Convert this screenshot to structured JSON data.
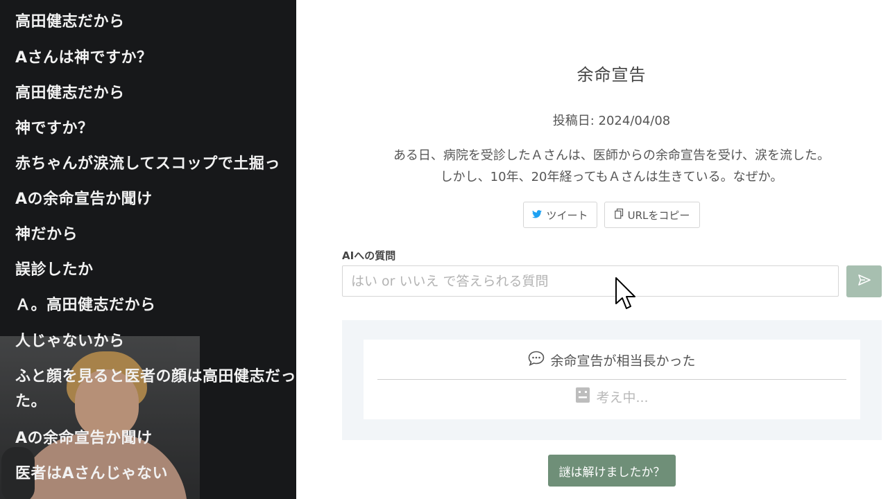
{
  "chat": {
    "messages": [
      "高田健志だから",
      "Aさんは神ですか？",
      "高田健志だから",
      "神ですか？",
      "赤ちゃんが涙流してスコップで土掘っ",
      "Aの余命宣告か聞け",
      "神だから",
      "誤診したか",
      "Ａ。高田健志だから",
      "人じゃないから",
      "ふと顔を見ると医者の顔は高田健志だった。",
      "Aの余命宣告か聞け",
      "医者はAさんじゃない"
    ]
  },
  "page": {
    "title": "余命宣告",
    "post_date": "投稿日: 2024/04/08",
    "story_line1": "ある日、病院を受診したＡさんは、医師からの余命宣告を受け、涙を流した。",
    "story_line2": "しかし、10年、20年経ってもＡさんは生きている。なぜか。",
    "share": {
      "tweet_label": "ツイート",
      "copy_label": "URLをコピー"
    },
    "question_label": "AIへの質問",
    "question_placeholder": "はい or いいえ で答えられる質問",
    "answer": {
      "question": "余命宣告が相当長かった",
      "status": "考え中..."
    },
    "solved_button": "謎は解けましたか？"
  },
  "colors": {
    "chat_bg": "#17181a",
    "send_button": "#a7bfb0",
    "solved_button": "#6f8f78",
    "answer_area": "#f2f5f8",
    "twitter_blue": "#1da1f2"
  },
  "icons": [
    "twitter-icon",
    "copy-icon",
    "send-icon",
    "chat-bubble-icon",
    "robot-icon",
    "mouse-cursor-icon"
  ]
}
